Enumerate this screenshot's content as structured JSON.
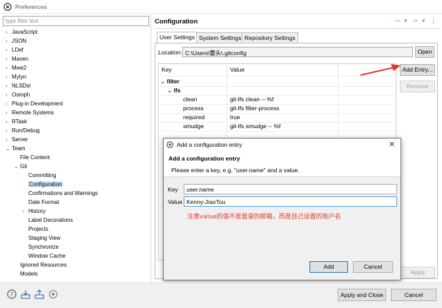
{
  "window": {
    "title": "Preferences"
  },
  "filter": {
    "placeholder": "type filter text"
  },
  "tree": [
    {
      "label": "JavaScript",
      "chev": "›",
      "indent": 0
    },
    {
      "label": "JSON",
      "chev": "›",
      "indent": 0
    },
    {
      "label": "LDef",
      "chev": "›",
      "indent": 0
    },
    {
      "label": "Maven",
      "chev": "›",
      "indent": 0
    },
    {
      "label": "Mwe2",
      "chev": "›",
      "indent": 0
    },
    {
      "label": "Mylyn",
      "chev": "›",
      "indent": 0
    },
    {
      "label": "NLSDsl",
      "chev": "›",
      "indent": 0
    },
    {
      "label": "Oomph",
      "chev": "›",
      "indent": 0
    },
    {
      "label": "Plug-in Development",
      "chev": "›",
      "indent": 0
    },
    {
      "label": "Remote Systems",
      "chev": "›",
      "indent": 0
    },
    {
      "label": "RTask",
      "chev": "›",
      "indent": 0
    },
    {
      "label": "Run/Debug",
      "chev": "›",
      "indent": 0
    },
    {
      "label": "Server",
      "chev": "›",
      "indent": 0
    },
    {
      "label": "Team",
      "chev": "⌄",
      "indent": 0
    },
    {
      "label": "File Content",
      "chev": "",
      "indent": 1
    },
    {
      "label": "Git",
      "chev": "⌄",
      "indent": 1
    },
    {
      "label": "Committing",
      "chev": "",
      "indent": 2
    },
    {
      "label": "Configuration",
      "chev": "",
      "indent": 2,
      "selected": true
    },
    {
      "label": "Confirmations and Warnings",
      "chev": "",
      "indent": 2
    },
    {
      "label": "Date Format",
      "chev": "",
      "indent": 2
    },
    {
      "label": "History",
      "chev": "›",
      "indent": 2
    },
    {
      "label": "Label Decorations",
      "chev": "",
      "indent": 2
    },
    {
      "label": "Projects",
      "chev": "",
      "indent": 2
    },
    {
      "label": "Staging View",
      "chev": "",
      "indent": 2
    },
    {
      "label": "Synchronize",
      "chev": "",
      "indent": 2
    },
    {
      "label": "Window Cache",
      "chev": "",
      "indent": 2
    },
    {
      "label": "Ignored Resources",
      "chev": "",
      "indent": 1
    },
    {
      "label": "Models",
      "chev": "",
      "indent": 1
    }
  ],
  "page": {
    "title": "Configuration"
  },
  "tabs": [
    "User Settings",
    "System Settings",
    "Repository Settings"
  ],
  "location": {
    "label": "Location:",
    "value": "C:\\Users\\蕾头\\.gitconfig",
    "open_label": "Open"
  },
  "table": {
    "col_key": "Key",
    "col_value": "Value",
    "section": "filter",
    "subsection": "lfs",
    "rows": [
      {
        "key": "clean",
        "value": "git-lfs clean -- %f"
      },
      {
        "key": "process",
        "value": "git-lfs filter-process"
      },
      {
        "key": "required",
        "value": "true"
      },
      {
        "key": "smudge",
        "value": "git-lfs smudge -- %f"
      }
    ]
  },
  "buttons": {
    "add_entry": "Add Entry...",
    "remove": "Remove",
    "apply": "Apply",
    "apply_close": "Apply and Close",
    "cancel": "Cancel"
  },
  "dialog": {
    "title": "Add a configuration entry",
    "heading": "Add a configuration entry",
    "description": "Please enter a key, e.g. \"user.name\" and a value.",
    "key_label": "Key",
    "key_value": "user.name",
    "value_label": "Value",
    "value_value": "Kenny-JiaoTou",
    "note": "注意value的值不是登录的邮箱，而是自己设置的账户名",
    "add_label": "Add",
    "cancel_label": "Cancel"
  },
  "colors": {
    "accent": "#3c7fb1",
    "annotation": "#e0362b",
    "selection": "#cce4f7"
  }
}
